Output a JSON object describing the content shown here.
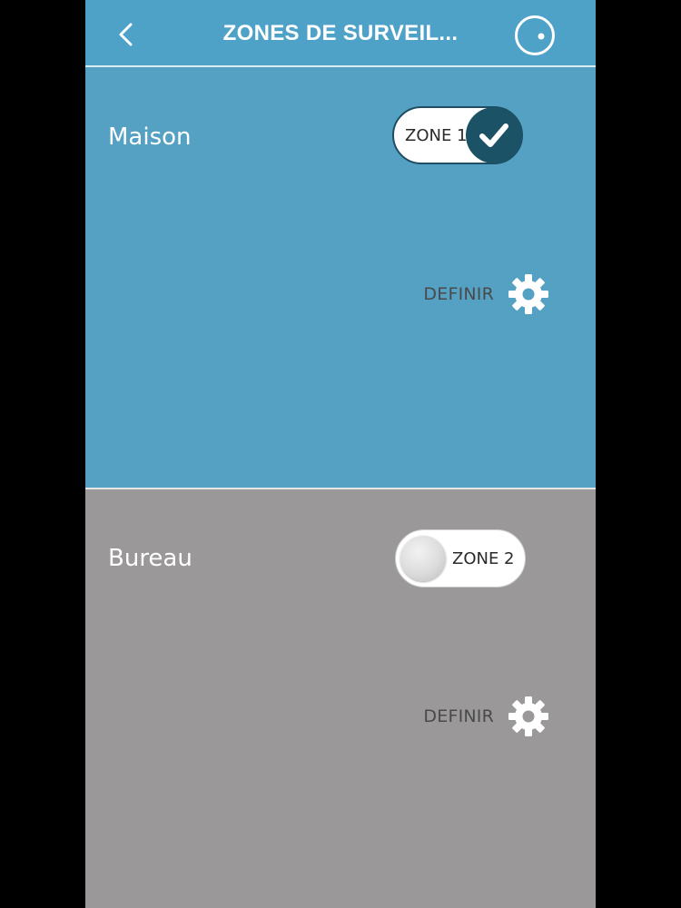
{
  "header": {
    "title": "ZONES DE SURVEIL...",
    "back_icon": "chevron-left-icon",
    "action_icon": "target-icon"
  },
  "zones": [
    {
      "name": "Maison",
      "toggle_label": "ZONE 1",
      "toggle_state": "on",
      "define_label": "DEFINIR",
      "define_icon": "gear-icon",
      "background": "#54a1c4"
    },
    {
      "name": "Bureau",
      "toggle_label": "ZONE 2",
      "toggle_state": "off",
      "define_label": "DEFINIR",
      "define_icon": "gear-icon",
      "background": "#9a9899"
    }
  ],
  "colors": {
    "header_bg": "#4fa2c7",
    "toggle_on_knob": "#1c5266",
    "text_light": "#ffffff",
    "text_dark": "#4a4a4a"
  }
}
